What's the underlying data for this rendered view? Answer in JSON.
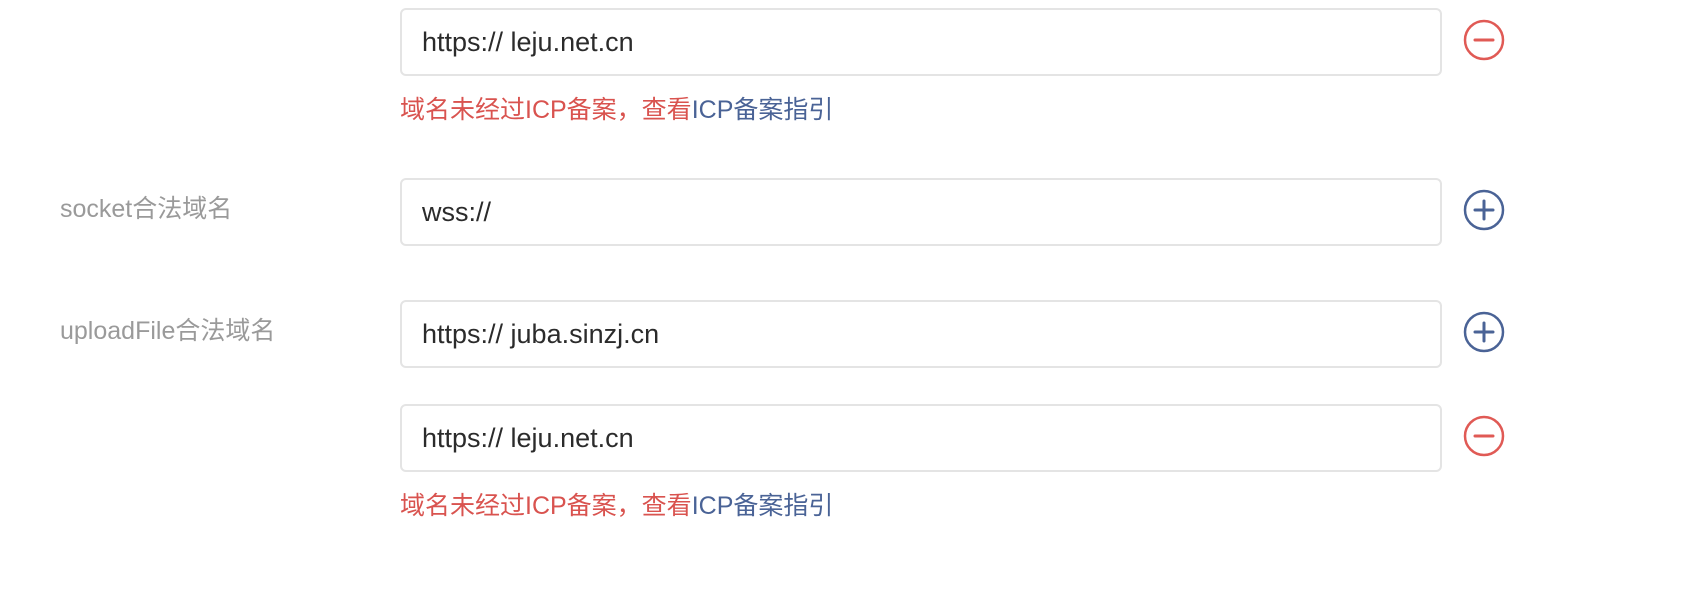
{
  "colors": {
    "warning": "#d9534f",
    "link": "#4a6396",
    "label": "#9a9a9a",
    "remove_icon": "#e05a55",
    "add_icon": "#4a6396"
  },
  "request_domain": {
    "extra_value": "https:// leju.net.cn",
    "remove_icon": "minus-circle-icon",
    "warning_text": "域名未经过ICP备案，查看",
    "guide_link": "ICP备案指引"
  },
  "socket_domain": {
    "label": "socket合法域名",
    "value": "wss://",
    "add_icon": "plus-circle-icon"
  },
  "upload_domain": {
    "label": "uploadFile合法域名",
    "value": "https:// juba.sinzj.cn",
    "add_icon": "plus-circle-icon",
    "extra_value": "https:// leju.net.cn",
    "remove_icon": "minus-circle-icon",
    "warning_text": "域名未经过ICP备案，查看",
    "guide_link": "ICP备案指引"
  }
}
